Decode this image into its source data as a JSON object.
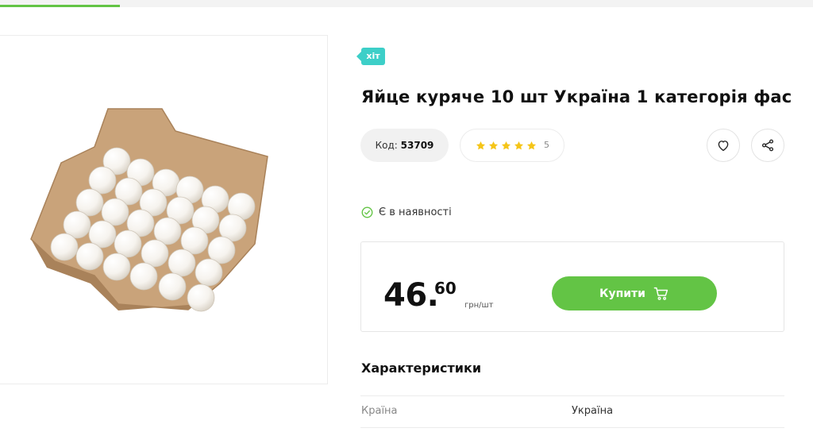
{
  "progress": {
    "fraction": 0.147
  },
  "product": {
    "badge": "хіт",
    "title": "Яйце куряче 10 шт Україна 1 категорія фас",
    "code_label": "Код:",
    "code_value": "53709",
    "rating_stars": 5,
    "rating_count": "5",
    "stock_text": "Є в наявності",
    "price_int": "46.",
    "price_frac": "60",
    "price_unit": "грн/шт",
    "buy_label": "Купити"
  },
  "characteristics": {
    "title": "Характеристики",
    "rows": [
      {
        "label": "Країна",
        "value": "Україна"
      }
    ]
  },
  "colors": {
    "accent_green": "#63c445",
    "badge_teal": "#3dcfc8",
    "star_yellow": "#f5c518"
  },
  "icons": [
    "heart-icon",
    "share-icon",
    "check-circle-icon",
    "cart-icon",
    "star-icon"
  ]
}
